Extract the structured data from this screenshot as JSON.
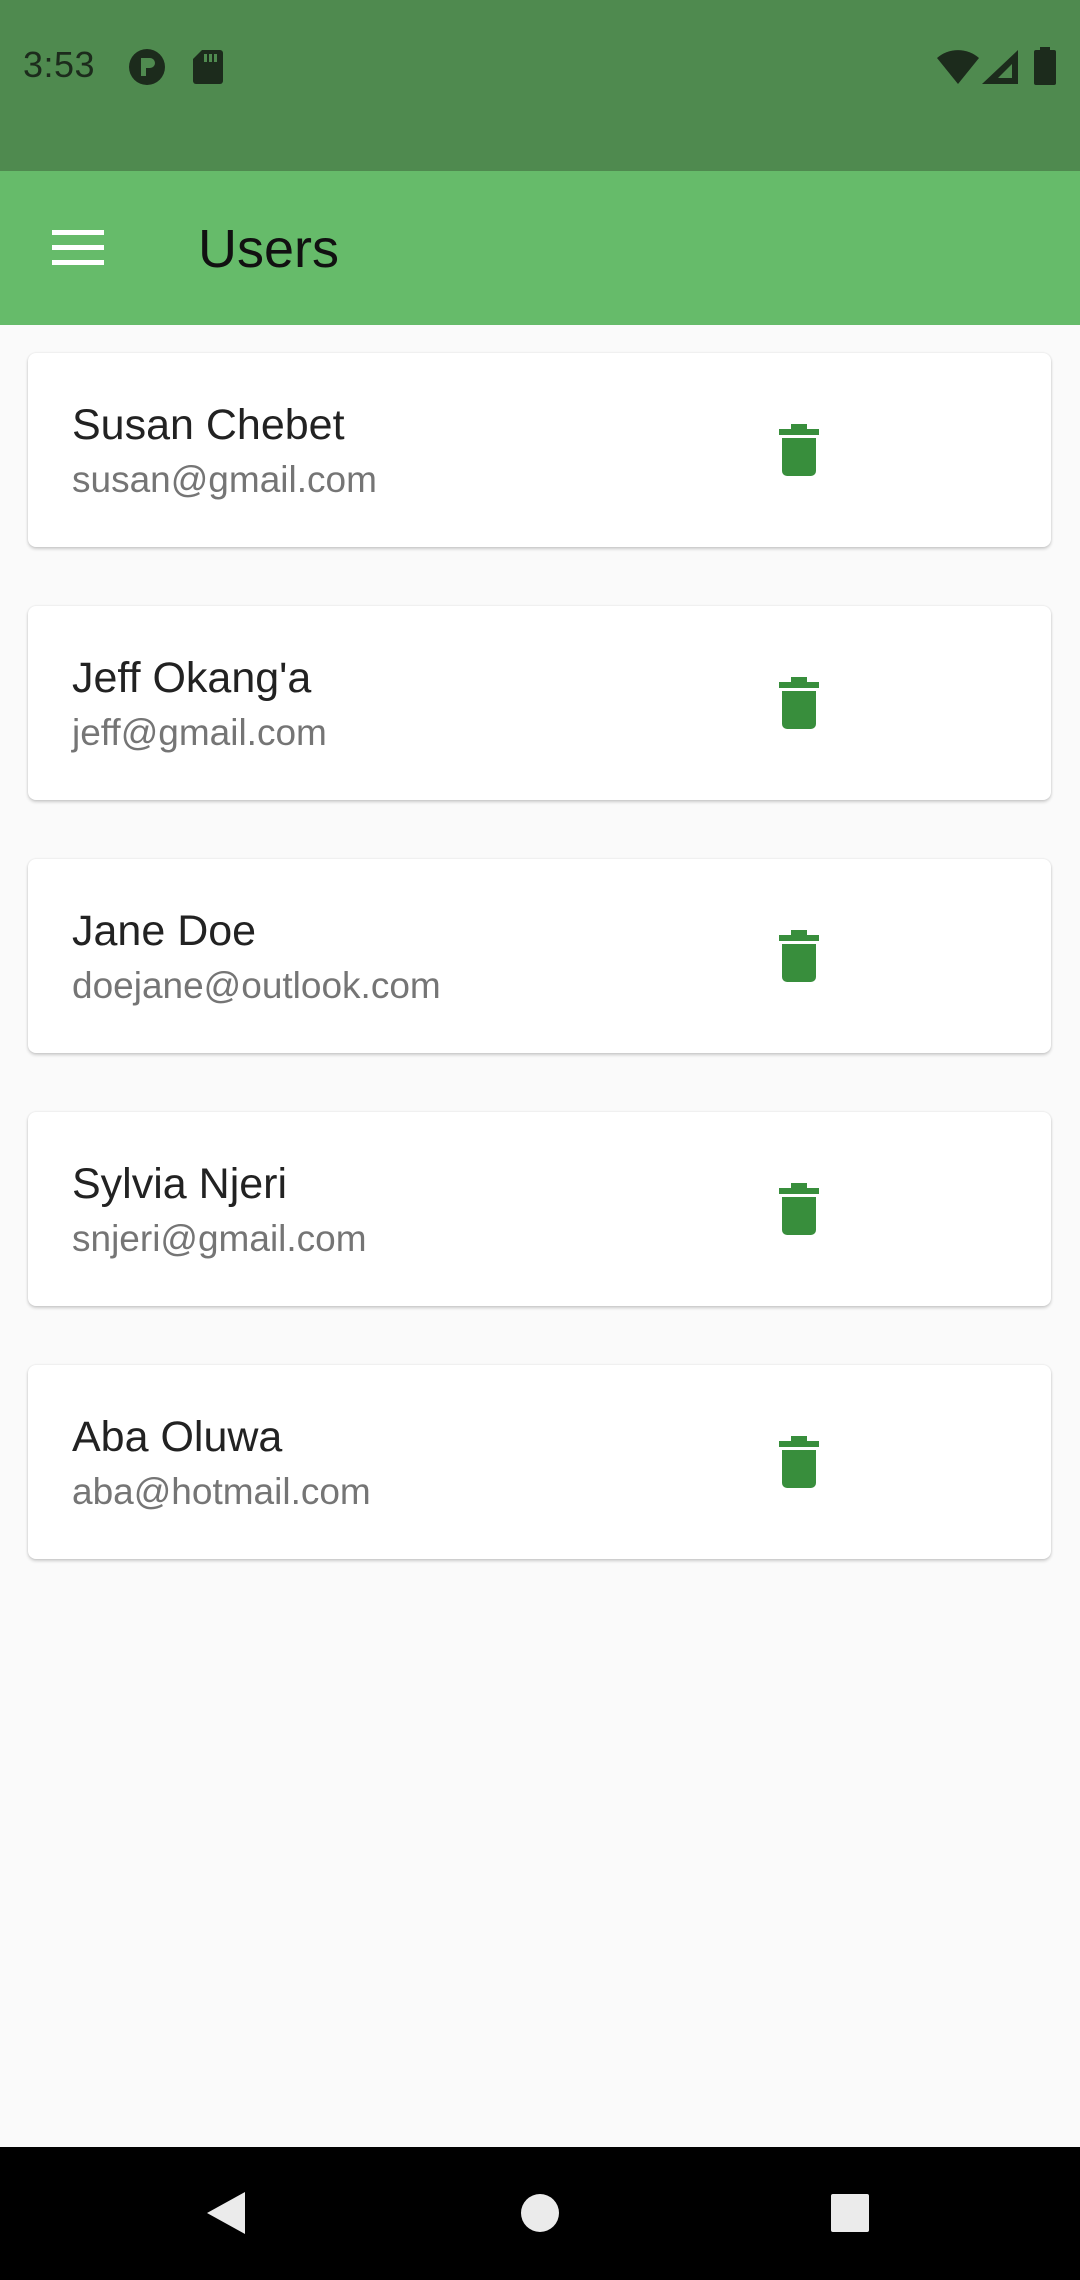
{
  "status_bar": {
    "time": "3:53",
    "icons": [
      "notification-p-icon",
      "sd-card-icon",
      "wifi-icon",
      "signal-icon",
      "battery-icon"
    ],
    "bg_color": "#4f8a4f"
  },
  "app_bar": {
    "title": "Users",
    "menu_icon": "hamburger-menu-icon",
    "bg_color": "#66bb6a"
  },
  "users": [
    {
      "name": "Susan Chebet",
      "email": "susan@gmail.com"
    },
    {
      "name": "Jeff Okang'a",
      "email": "jeff@gmail.com"
    },
    {
      "name": "Jane Doe",
      "email": "doejane@outlook.com"
    },
    {
      "name": "Sylvia Njeri",
      "email": "snjeri@gmail.com"
    },
    {
      "name": "Aba Oluwa",
      "email": "aba@hotmail.com"
    }
  ],
  "delete_icon": "trash-icon",
  "accent_color": "#388e3c",
  "nav_bar": {
    "buttons": [
      "back-icon",
      "home-icon",
      "recents-icon"
    ]
  }
}
